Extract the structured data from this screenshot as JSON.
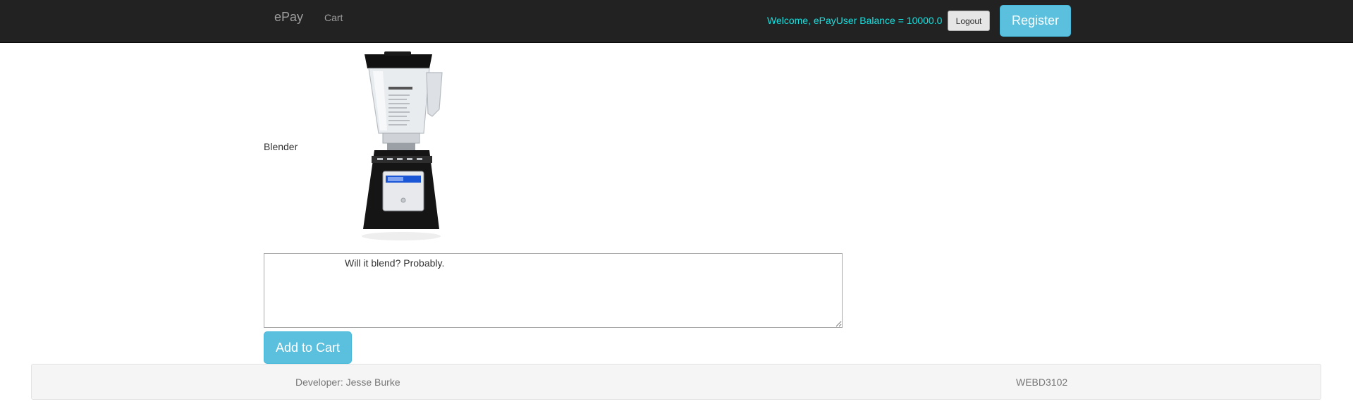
{
  "navbar": {
    "brand": "ePay",
    "links": [
      {
        "label": "Cart"
      }
    ],
    "welcome_text": "Welcome, ePayUser Balance = 10000.0",
    "logout_label": "Logout",
    "register_label": "Register"
  },
  "product": {
    "name": "Blender",
    "image_icon": "blender-product-image",
    "description": "Will it blend? Probably.",
    "add_to_cart_label": "Add to Cart"
  },
  "footer": {
    "developer": "Developer: Jesse Burke",
    "course_code": "WEBD3102"
  },
  "colors": {
    "navbar_bg": "#222222",
    "welcome_text": "#16e0e0",
    "info_button": "#5bc0de",
    "footer_bg": "#f5f5f5"
  }
}
